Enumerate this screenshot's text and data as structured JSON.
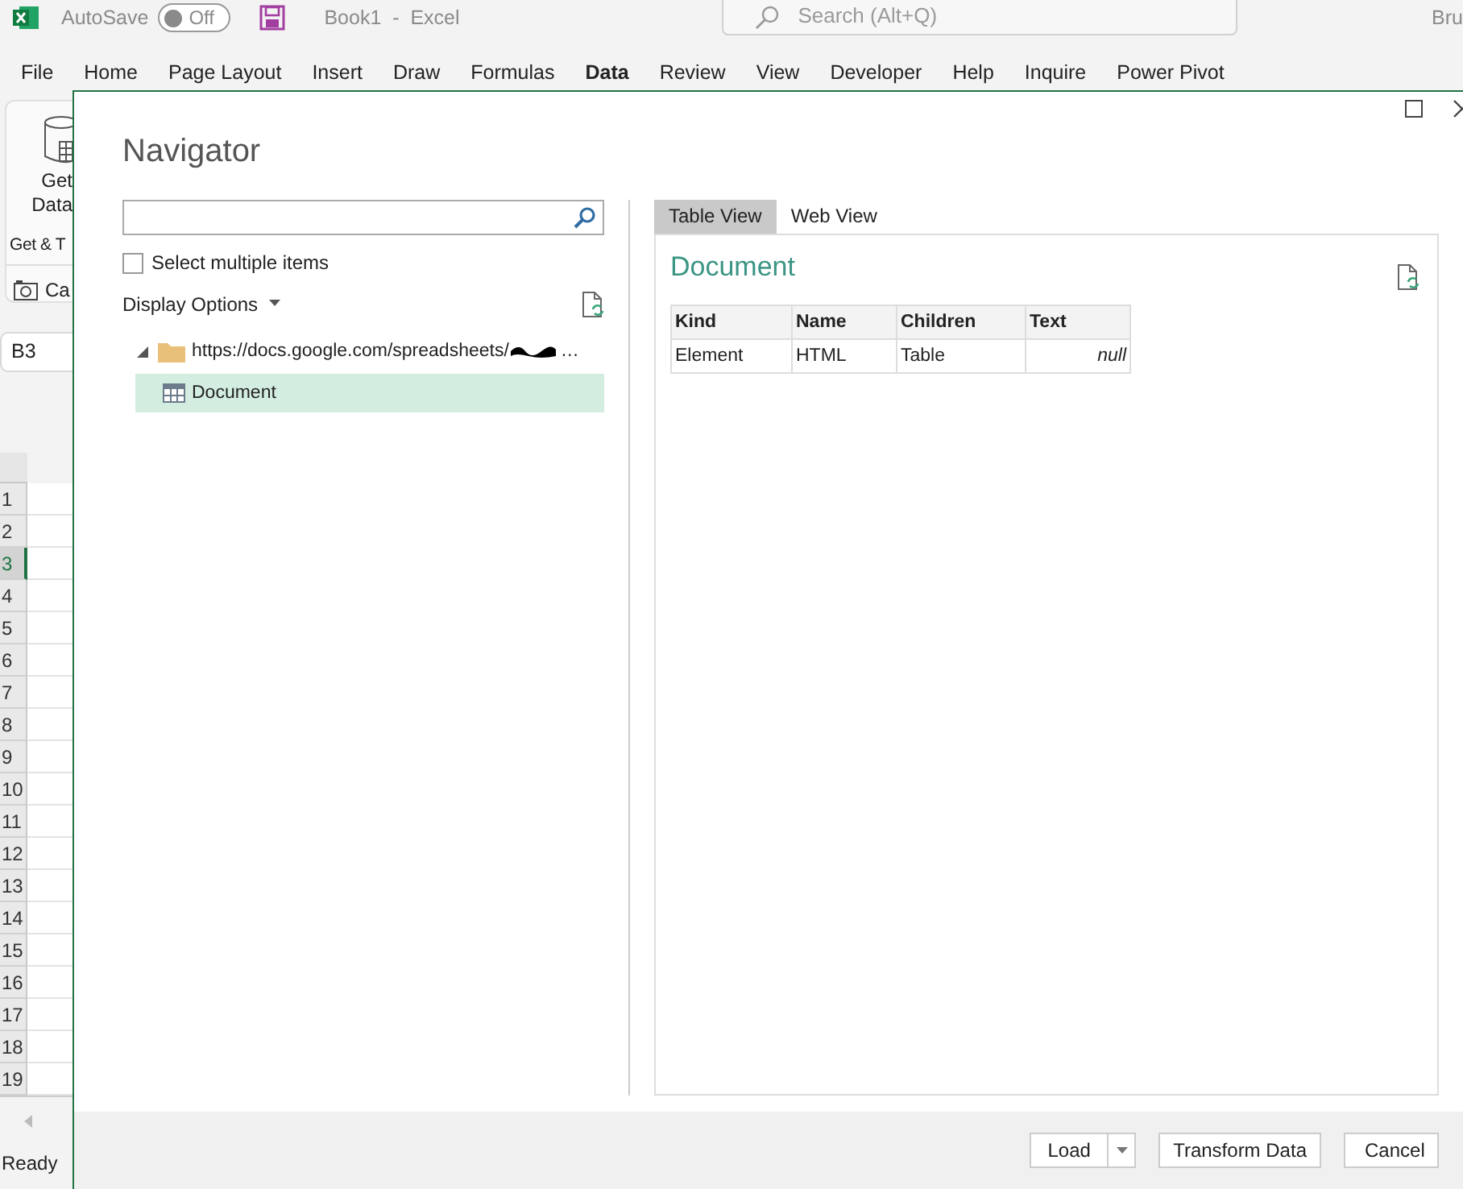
{
  "excel": {
    "title_bar": {
      "autosave_label": "AutoSave",
      "autosave": {
        "on": false,
        "label": "Off"
      },
      "document_title": "Book1  -  Excel",
      "search": {
        "placeholder": "Search (Alt+Q)"
      },
      "user": "Bru"
    },
    "ribbon_tabs": [
      {
        "label": "File",
        "selected": false
      },
      {
        "label": "Home",
        "selected": false
      },
      {
        "label": "Page Layout",
        "selected": false
      },
      {
        "label": "Insert",
        "selected": false
      },
      {
        "label": "Draw",
        "selected": false
      },
      {
        "label": "Formulas",
        "selected": false
      },
      {
        "label": "Data",
        "selected": true
      },
      {
        "label": "Review",
        "selected": false
      },
      {
        "label": "View",
        "selected": false
      },
      {
        "label": "Developer",
        "selected": false
      },
      {
        "label": "Help",
        "selected": false
      },
      {
        "label": "Inquire",
        "selected": false
      },
      {
        "label": "Power Pivot",
        "selected": false
      }
    ],
    "ribbon": {
      "get_data_lines": [
        "Get",
        "Data"
      ],
      "group_label": "Get & T",
      "camera_label": "Ca"
    },
    "name_box": "B3",
    "rows": [
      {
        "label": "1",
        "selected": false
      },
      {
        "label": "2",
        "selected": false
      },
      {
        "label": "3",
        "selected": true
      },
      {
        "label": "4",
        "selected": false
      },
      {
        "label": "5",
        "selected": false
      },
      {
        "label": "6",
        "selected": false
      },
      {
        "label": "7",
        "selected": false
      },
      {
        "label": "8",
        "selected": false
      },
      {
        "label": "9",
        "selected": false
      },
      {
        "label": "10",
        "selected": false
      },
      {
        "label": "11",
        "selected": false
      },
      {
        "label": "12",
        "selected": false
      },
      {
        "label": "13",
        "selected": false
      },
      {
        "label": "14",
        "selected": false
      },
      {
        "label": "15",
        "selected": false
      },
      {
        "label": "16",
        "selected": false
      },
      {
        "label": "17",
        "selected": false
      },
      {
        "label": "18",
        "selected": false
      },
      {
        "label": "19",
        "selected": false
      }
    ],
    "status_bar": "Ready"
  },
  "dialog": {
    "title": "Navigator",
    "select_multiple": {
      "label": "Select multiple items",
      "checked": false
    },
    "display_options": "Display Options",
    "tree": [
      {
        "label": "https://docs.google.com/spreadsheets/",
        "redacted": true,
        "trailing": "…",
        "kind": "folder",
        "expanded": true,
        "children": [
          {
            "label": "Document",
            "kind": "table",
            "selected": true
          }
        ]
      }
    ],
    "preview": {
      "tabs": [
        {
          "label": "Table View",
          "selected": true
        },
        {
          "label": "Web View",
          "selected": false
        }
      ],
      "title": "Document",
      "table": {
        "columns": [
          "Kind",
          "Name",
          "Children",
          "Text"
        ],
        "rows": [
          {
            "cells": [
              {
                "text": "Element",
                "kind": "text"
              },
              {
                "text": "HTML",
                "kind": "text"
              },
              {
                "text": "Table",
                "kind": "text"
              },
              {
                "text": "null",
                "kind": "null"
              }
            ]
          }
        ]
      }
    },
    "buttons": [
      {
        "label": "Load",
        "kind": "split"
      },
      {
        "label": "Transform Data",
        "kind": "plain"
      },
      {
        "label": "Cancel",
        "kind": "plain"
      }
    ]
  }
}
